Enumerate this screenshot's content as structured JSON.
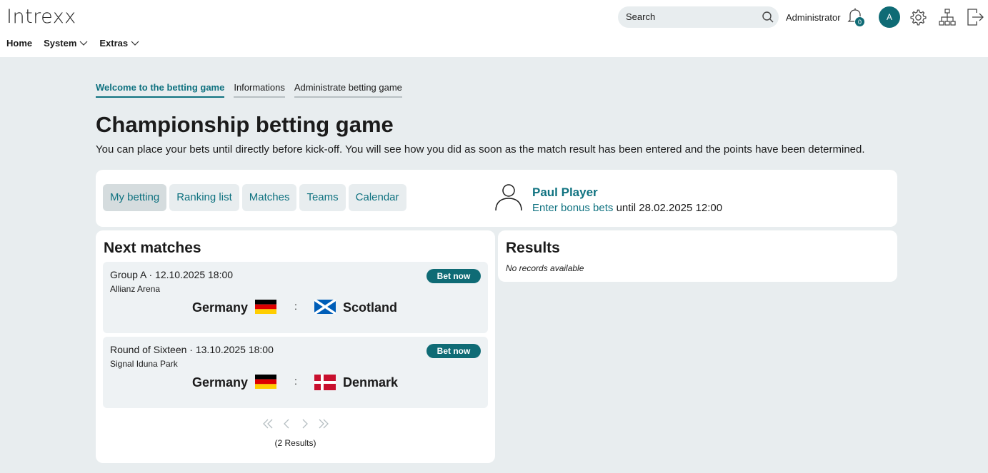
{
  "app": {
    "logo": "Intrexx"
  },
  "main_nav": [
    {
      "label": "Home",
      "has_menu": false
    },
    {
      "label": "System",
      "has_menu": true
    },
    {
      "label": "Extras",
      "has_menu": true
    }
  ],
  "header": {
    "search_placeholder": "Search",
    "user_label": "Administrator",
    "notification_count": "0",
    "avatar_initial": "A"
  },
  "tabs": [
    {
      "label": "Welcome to the betting game",
      "active": true
    },
    {
      "label": "Informations",
      "active": false
    },
    {
      "label": "Administrate betting game",
      "active": false
    }
  ],
  "page": {
    "title": "Championship betting game",
    "intro": "You can place your bets until directly before kick-off. You will see how you did as soon as the match result has been entered and the points have been determined."
  },
  "betting_nav": [
    {
      "label": "My betting",
      "selected": true
    },
    {
      "label": "Ranking list",
      "selected": false
    },
    {
      "label": "Matches",
      "selected": false
    },
    {
      "label": "Teams",
      "selected": false
    },
    {
      "label": "Calendar",
      "selected": false
    }
  ],
  "player": {
    "name": "Paul Player",
    "bonus_link": "Enter bonus bets",
    "until_text": "until",
    "deadline": "28.02.2025 12:00"
  },
  "next_matches": {
    "title": "Next matches",
    "bet_button_label": "Bet now",
    "matches": [
      {
        "stage": "Group A",
        "datetime": "12.10.2025 18:00",
        "venue": "Allianz Arena",
        "home": "Germany",
        "home_flag": "flag-germany-icon",
        "away": "Scotland",
        "away_flag": "flag-scotland-icon"
      },
      {
        "stage": "Round of Sixteen",
        "datetime": "13.10.2025 18:00",
        "venue": "Signal Iduna Park",
        "home": "Germany",
        "home_flag": "flag-germany-icon",
        "away": "Denmark",
        "away_flag": "flag-denmark-icon"
      }
    ],
    "results_count": "(2 Results)"
  },
  "results": {
    "title": "Results",
    "empty_text": "No records available"
  },
  "colors": {
    "accent": "#0f7280",
    "button": "#0f6b75",
    "background": "#e8edef"
  }
}
